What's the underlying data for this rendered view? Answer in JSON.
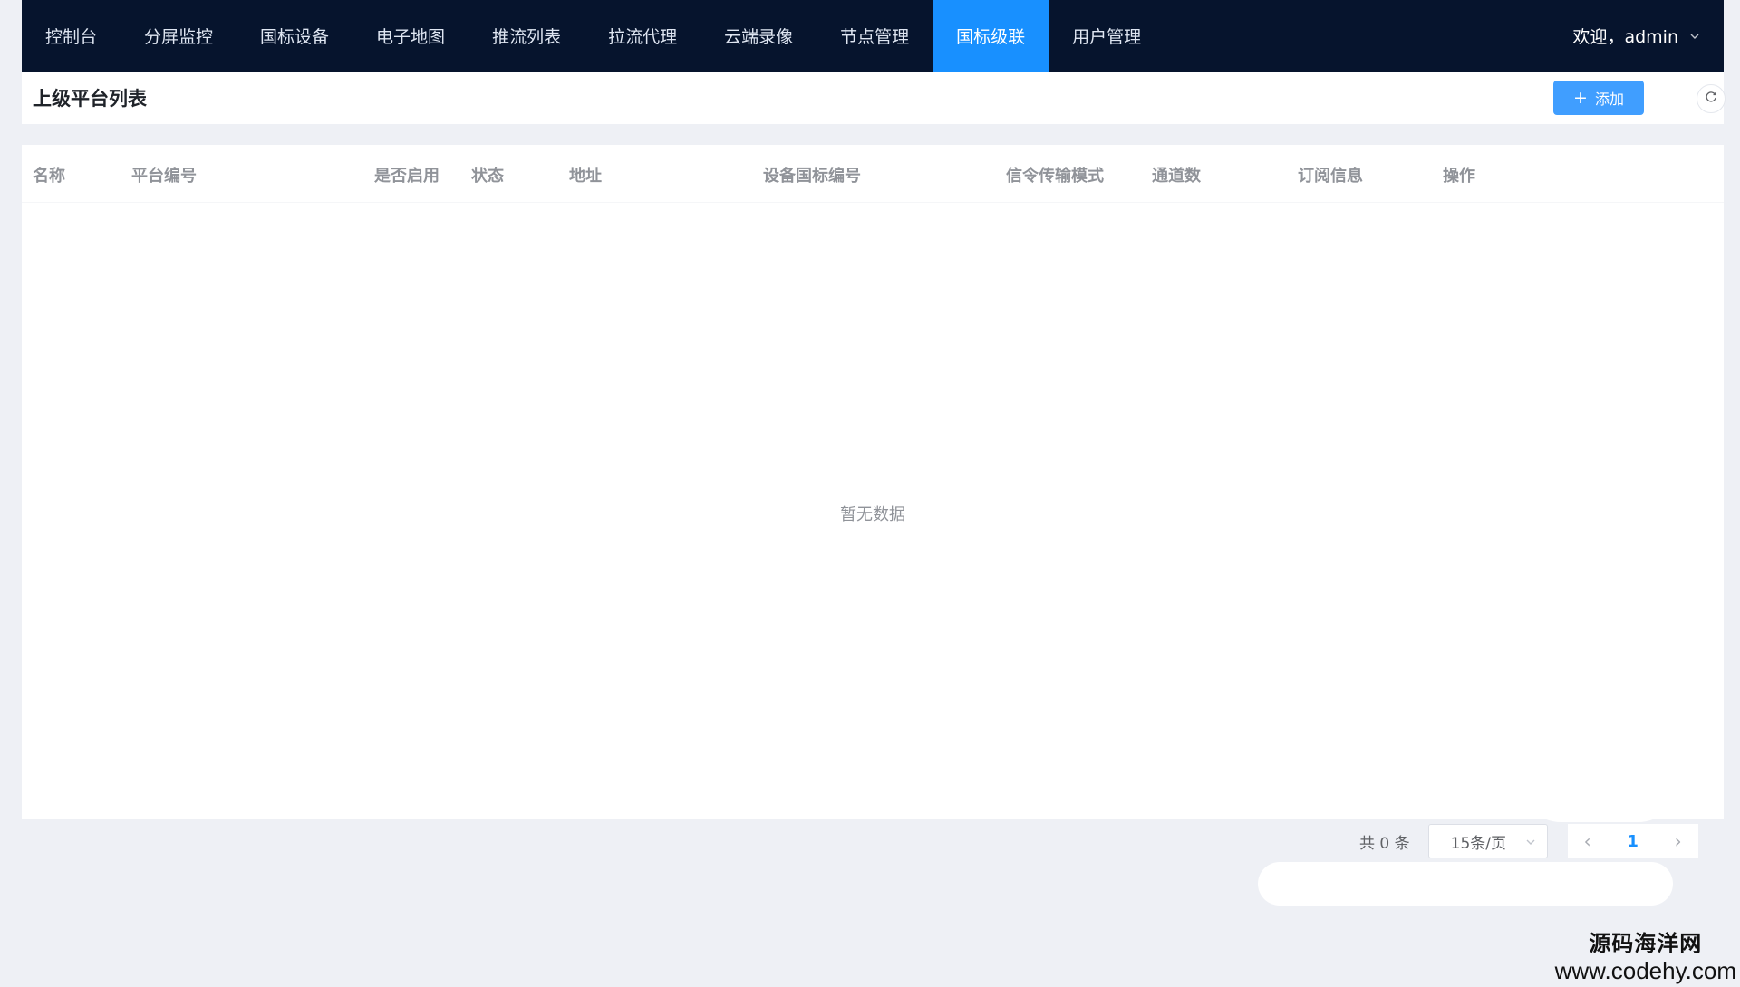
{
  "nav": {
    "items": [
      {
        "label": "控制台",
        "active": false
      },
      {
        "label": "分屏监控",
        "active": false
      },
      {
        "label": "国标设备",
        "active": false
      },
      {
        "label": "电子地图",
        "active": false
      },
      {
        "label": "推流列表",
        "active": false
      },
      {
        "label": "拉流代理",
        "active": false
      },
      {
        "label": "云端录像",
        "active": false
      },
      {
        "label": "节点管理",
        "active": false
      },
      {
        "label": "国标级联",
        "active": true
      },
      {
        "label": "用户管理",
        "active": false
      }
    ],
    "user_greeting": "欢迎，admin",
    "active_color": "#1890ff",
    "bar_color": "#06142d"
  },
  "header": {
    "title": "上级平台列表",
    "add_label": "添加"
  },
  "table": {
    "columns": [
      "名称",
      "平台编号",
      "是否启用",
      "状态",
      "地址",
      "设备国标编号",
      "信令传输模式",
      "通道数",
      "订阅信息",
      "操作"
    ],
    "rows": [],
    "empty_text": "暂无数据"
  },
  "pagination": {
    "total_text": "共 0 条",
    "page_size": "15条/页",
    "current_page": "1"
  },
  "watermark": {
    "name": "源码海洋网",
    "url": "www.codehy.com"
  }
}
